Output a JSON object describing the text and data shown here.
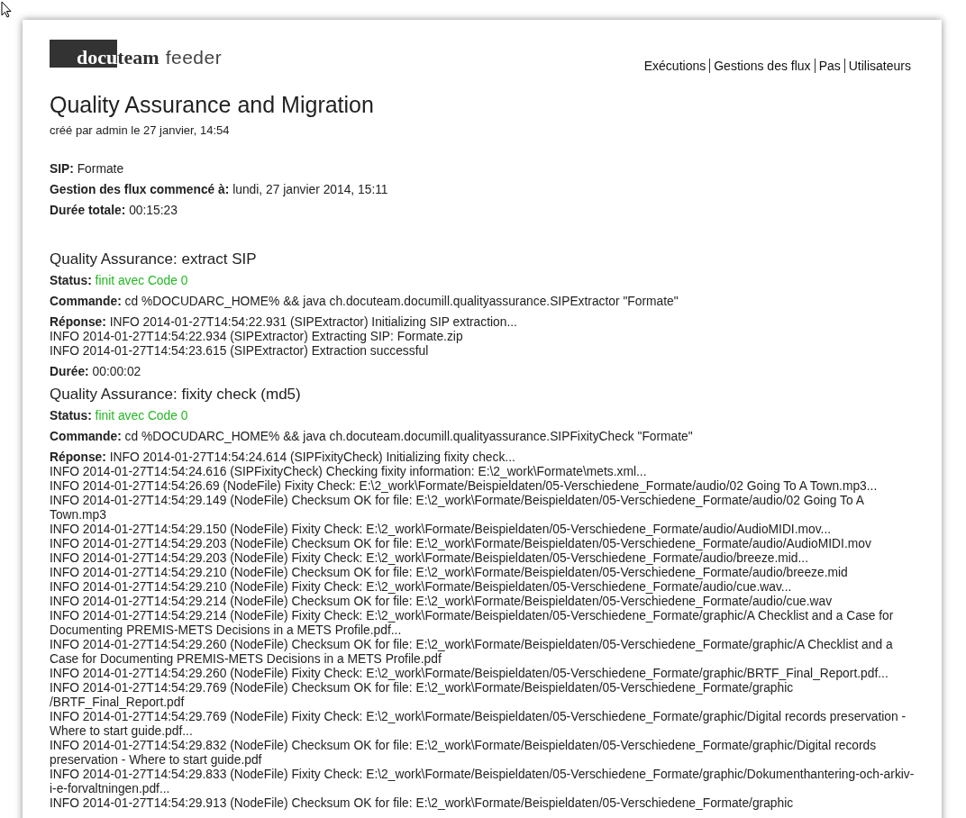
{
  "logo": {
    "block": "docu",
    "rest": "team",
    "product": "feeder"
  },
  "nav": [
    "Exécutions",
    "Gestions des flux",
    "Pas",
    "Utilisateurs"
  ],
  "title": "Quality Assurance and Migration",
  "subtitle": "créé par admin le 27 janvier, 14:54",
  "summary": [
    {
      "label": "SIP:",
      "value": "Formate"
    },
    {
      "label": "Gestion des flux commencé à:",
      "value": "lundi, 27 janvier 2014, 15:11"
    },
    {
      "label": "Durée totale:",
      "value": "00:15:23"
    }
  ],
  "steps": [
    {
      "title": "Quality Assurance: extract SIP",
      "status_label": "Status:",
      "status": "finit avec Code 0",
      "command_label": "Commande:",
      "command": "cd %DOCUDARC_HOME% && java ch.docuteam.documill.qualityassurance.SIPExtractor \"Formate\"",
      "response_label": "Réponse:",
      "response": [
        "INFO 2014-01-27T14:54:22.931 (SIPExtractor) Initializing SIP extraction...",
        "INFO 2014-01-27T14:54:22.934 (SIPExtractor) Extracting SIP: Formate.zip",
        "INFO 2014-01-27T14:54:23.615 (SIPExtractor) Extraction successful"
      ],
      "duration_label": "Durée:",
      "duration": "00:00:02"
    },
    {
      "title": "Quality Assurance: fixity check (md5)",
      "status_label": "Status:",
      "status": "finit avec Code 0",
      "command_label": "Commande:",
      "command": "cd %DOCUDARC_HOME% && java ch.docuteam.documill.qualityassurance.SIPFixityCheck \"Formate\"",
      "response_label": "Réponse:",
      "response": [
        "INFO 2014-01-27T14:54:24.614 (SIPFixityCheck) Initializing fixity check...",
        "INFO 2014-01-27T14:54:24.616 (SIPFixityCheck) Checking fixity information: E:\\2_work\\Formate\\mets.xml...",
        "INFO 2014-01-27T14:54:26.69 (NodeFile) Fixity Check: E:\\2_work\\Formate/Beispieldaten/05-Verschiedene_Formate/audio/02 Going To A Town.mp3...",
        "INFO 2014-01-27T14:54:29.149 (NodeFile) Checksum OK for file: E:\\2_work\\Formate/Beispieldaten/05-Verschiedene_Formate/audio/02 Going To A Town.mp3",
        "INFO 2014-01-27T14:54:29.150 (NodeFile) Fixity Check: E:\\2_work\\Formate/Beispieldaten/05-Verschiedene_Formate/audio/AudioMIDI.mov...",
        "INFO 2014-01-27T14:54:29.203 (NodeFile) Checksum OK for file: E:\\2_work\\Formate/Beispieldaten/05-Verschiedene_Formate/audio/AudioMIDI.mov",
        "INFO 2014-01-27T14:54:29.203 (NodeFile) Fixity Check: E:\\2_work\\Formate/Beispieldaten/05-Verschiedene_Formate/audio/breeze.mid...",
        "INFO 2014-01-27T14:54:29.210 (NodeFile) Checksum OK for file: E:\\2_work\\Formate/Beispieldaten/05-Verschiedene_Formate/audio/breeze.mid",
        "INFO 2014-01-27T14:54:29.210 (NodeFile) Fixity Check: E:\\2_work\\Formate/Beispieldaten/05-Verschiedene_Formate/audio/cue.wav...",
        "INFO 2014-01-27T14:54:29.214 (NodeFile) Checksum OK for file: E:\\2_work\\Formate/Beispieldaten/05-Verschiedene_Formate/audio/cue.wav",
        "INFO 2014-01-27T14:54:29.214 (NodeFile) Fixity Check: E:\\2_work\\Formate/Beispieldaten/05-Verschiedene_Formate/graphic/A Checklist and a Case for Documenting PREMIS-METS Decisions in a METS Profile.pdf...",
        "INFO 2014-01-27T14:54:29.260 (NodeFile) Checksum OK for file: E:\\2_work\\Formate/Beispieldaten/05-Verschiedene_Formate/graphic/A Checklist and a Case for Documenting PREMIS-METS Decisions in a METS Profile.pdf",
        "INFO 2014-01-27T14:54:29.260 (NodeFile) Fixity Check: E:\\2_work\\Formate/Beispieldaten/05-Verschiedene_Formate/graphic/BRTF_Final_Report.pdf...",
        "INFO 2014-01-27T14:54:29.769 (NodeFile) Checksum OK for file: E:\\2_work\\Formate/Beispieldaten/05-Verschiedene_Formate/graphic /BRTF_Final_Report.pdf",
        "INFO 2014-01-27T14:54:29.769 (NodeFile) Fixity Check: E:\\2_work\\Formate/Beispieldaten/05-Verschiedene_Formate/graphic/Digital records preservation - Where to start guide.pdf...",
        "INFO 2014-01-27T14:54:29.832 (NodeFile) Checksum OK for file: E:\\2_work\\Formate/Beispieldaten/05-Verschiedene_Formate/graphic/Digital records preservation - Where to start guide.pdf",
        "INFO 2014-01-27T14:54:29.833 (NodeFile) Fixity Check: E:\\2_work\\Formate/Beispieldaten/05-Verschiedene_Formate/graphic/Dokumenthantering-och-arkiv-i-e-forvaltningen.pdf...",
        "INFO 2014-01-27T14:54:29.913 (NodeFile) Checksum OK for file: E:\\2_work\\Formate/Beispieldaten/05-Verschiedene_Formate/graphic"
      ]
    }
  ]
}
